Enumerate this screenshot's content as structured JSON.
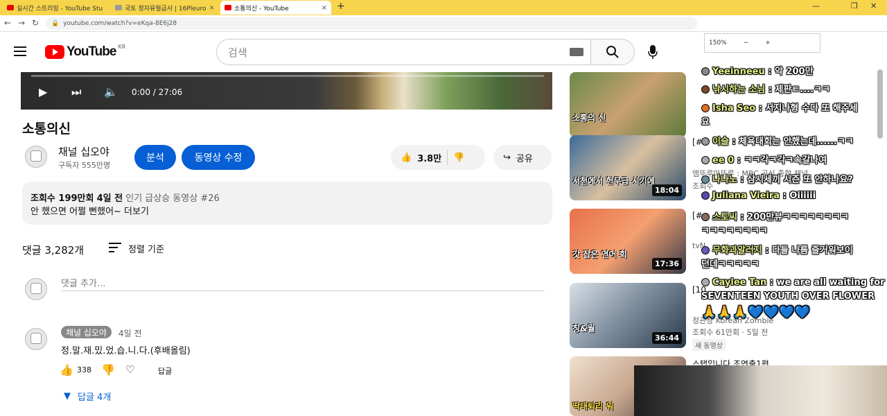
{
  "browser": {
    "tabs": [
      {
        "label": "실시간 스트리밍 - YouTube Stu"
      },
      {
        "label": "국토 정자유월급사 | 16Pleuro"
      },
      {
        "label": "소통의신 - YouTube"
      }
    ],
    "url": "youtube.com/watch?v=eKqa-8E6j28",
    "zoom": "150%",
    "zoom_minus": "−",
    "zoom_plus": "+"
  },
  "header": {
    "logo": "YouTube",
    "region": "KR",
    "search_placeholder": "검색"
  },
  "player": {
    "time": "0:00 / 27:06",
    "progress": 0
  },
  "video": {
    "title": "소통의신",
    "channel": "채널 십오야",
    "subscribers": "구독자 555만명",
    "btn_analysis": "분석",
    "btn_edit": "동영상 수정",
    "likes": "3.8만",
    "share": "공유"
  },
  "description": {
    "views": "조회수 199만회",
    "date": "4일 전",
    "trending": "인기 급상승 동영상 #26",
    "text": "안 했으면 어쩔 뻔했어~ 더보기"
  },
  "comments": {
    "count": "댓글 3,282개",
    "sort": "정렬 기준",
    "input_placeholder": "댓글 추가...",
    "items": [
      {
        "author": "채널 십오야",
        "date": "4일 전",
        "text": "정.말.재.밌.었.습.니.다.(후배올림)",
        "likes": "338",
        "reply_label": "답글",
        "replies": "답글 4개"
      }
    ]
  },
  "recommendations": [
    {
      "title": "",
      "meta": "",
      "duration": "",
      "caption": "소통의 신"
    },
    {
      "title": "[#",
      "meta": "엠뚜루마뚜루 : MBC 공식 종합 채널",
      "meta2": "조회수",
      "duration": "18:04",
      "caption": "서천에서 헌무급 시기에"
    },
    {
      "title": "[#",
      "meta": "tvN",
      "duration": "17:36",
      "caption": "갓 잡은 연어 회"
    },
    {
      "title": "[10",
      "meta": "정관장 Korean Zombie",
      "meta2": "조회수 61만회 · 5일 전",
      "badge": "새 동영상",
      "duration": "36:44",
      "caption": "칭&월"
    },
    {
      "title": "스탭입니다 조연출1편",
      "meta": "",
      "duration": "",
      "caption": "딱대퇴리 워"
    }
  ],
  "rec_badges": {
    "new": "새 동영상"
  },
  "chat": [
    {
      "name": "Yeeinneeu",
      "msg": ": 악 200만"
    },
    {
      "name": "낚시하는 소님",
      "msg": ": 제판ㅌ....ㅋㅋ"
    },
    {
      "name": "Isha Seo",
      "msg": ": 서지나형 수다 또 해주세"
    },
    {
      "name": "",
      "msg": "요"
    },
    {
      "name": "이슬",
      "msg": ": 체육대회는 안했는데......ㅋㅋ"
    },
    {
      "name": "ee 0",
      "msg": ": ㅋㅋ각ㅋ각ㅋ속갈나여"
    },
    {
      "name": "나나노",
      "msg": ": 삼시세끼 시즌 또 안하나요?"
    },
    {
      "name": "Juliana Vieira",
      "msg": ": Oiiiiii"
    },
    {
      "name": "스토씨",
      "msg": ": 200만뷰ㅋㅋㅋㅋㅋㅋㅋㅋ"
    },
    {
      "name": "",
      "msg": "ㅋㅋㅋㅋㅋㅋㅋㅋ"
    },
    {
      "name": "무화과알러지",
      "msg": ": 다들 나름 즐거워보이"
    },
    {
      "name": "",
      "msg": "던데ㅋㅋㅋㅋㅋ"
    },
    {
      "name": "Caylee Tan",
      "msg": ": we are all waiting for"
    },
    {
      "name": "",
      "msg": "SEVENTEEN YOUTH OVER FLOWER"
    },
    {
      "name": "",
      "msg": "🙏🙏🙏💙💙💙💙"
    }
  ]
}
